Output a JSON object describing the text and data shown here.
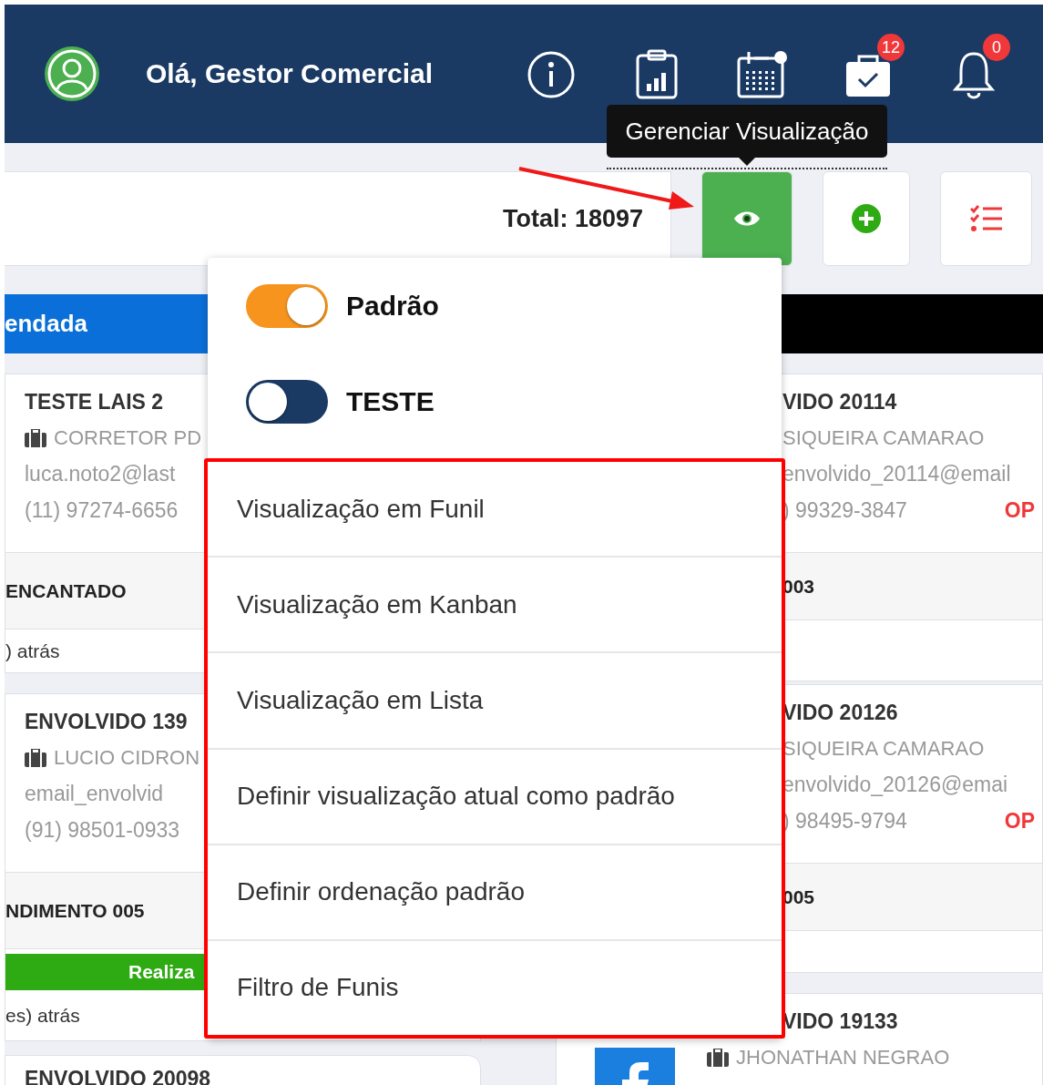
{
  "header": {
    "greeting": "Olá, Gestor Comercial",
    "actions": [
      {
        "kind": "info"
      },
      {
        "kind": "report"
      },
      {
        "kind": "calendar"
      },
      {
        "kind": "tasks",
        "badge": "12"
      },
      {
        "kind": "notifications",
        "badge": "0"
      }
    ]
  },
  "tooltip": "Gerenciar Visualização",
  "toolbar": {
    "total": "Total: 18097",
    "buttons": [
      {
        "kind": "view",
        "selected": true
      },
      {
        "kind": "add",
        "selected": false
      },
      {
        "kind": "checklist",
        "selected": false
      }
    ]
  },
  "columns": [
    {
      "header": "endada",
      "color": "#0a6fd8",
      "cards": [
        {
          "kind": "lead",
          "title": "TESTE LAIS 2",
          "owner": "CORRETOR PD",
          "briefcase": true,
          "email": "luca.noto2@last",
          "phone": "(11) 97274-6656",
          "stage": "ENCANTADO",
          "time": ") atrás"
        },
        {
          "kind": "lead",
          "title": "ENVOLVIDO 139",
          "owner": "LUCIO CIDRON",
          "briefcase": true,
          "email": "email_envolvid",
          "phone": "(91) 98501-0933",
          "stage": "NDIMENTO 005",
          "status": "Realiza",
          "time": "es) atrás"
        },
        {
          "kind": "lead",
          "title": "ENVOLVIDO 20098"
        }
      ]
    },
    {
      "color": "#000000",
      "cards": [
        {
          "kind": "lead",
          "title": "VIDO 20114",
          "owner": "SIQUEIRA CAMARAO",
          "briefcase": false,
          "email": "envolvido_20114@email",
          "phone": ") 99329-3847",
          "tag": "OP",
          "stage": "003"
        },
        {
          "kind": "lead",
          "title": "VIDO 20126",
          "owner": "SIQUEIRA CAMARAO",
          "briefcase": false,
          "email": "envolvido_20126@emai",
          "phone": ") 98495-9794",
          "tag": "OP",
          "stage": "005"
        },
        {
          "kind": "facebook",
          "title": "VIDO 19133",
          "owner": "JHONATHAN NEGRAO",
          "briefcase": true
        }
      ]
    }
  ],
  "menu": {
    "views": [
      {
        "label": "Padrão",
        "on": true
      },
      {
        "label": "TESTE",
        "on": false
      }
    ],
    "items": [
      "Visualização em Funil",
      "Visualização em Kanban",
      "Visualização em Lista",
      "Definir visualização atual como padrão",
      "Definir ordenação padrão",
      "Filtro de Funis"
    ]
  }
}
